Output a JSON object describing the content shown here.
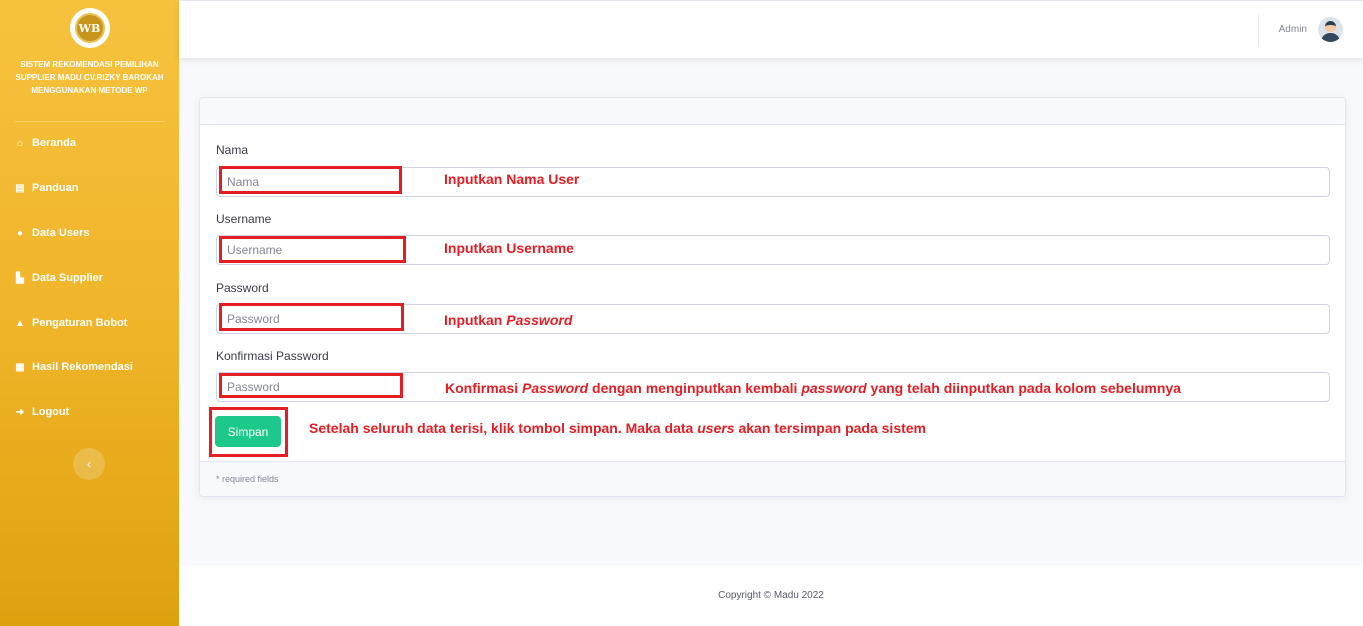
{
  "sidebar": {
    "logo_text": "WB",
    "brand_title": "SISTEM REKOMENDASI PEMILIHAN SUPPLIER MADU CV.RIZKY BAROKAH MENGGUNAKAN METODE WP",
    "items": [
      {
        "label": "Beranda",
        "icon": "home-icon"
      },
      {
        "label": "Panduan",
        "icon": "book-icon"
      },
      {
        "label": "Data Users",
        "icon": "users-icon"
      },
      {
        "label": "Data Supplier",
        "icon": "industry-icon"
      },
      {
        "label": "Pengaturan Bobot",
        "icon": "bell-icon"
      },
      {
        "label": "Hasil Rekomendasi",
        "icon": "calculator-icon"
      },
      {
        "label": "Logout",
        "icon": "sign-out-icon"
      }
    ],
    "toggle_icon": "‹"
  },
  "topbar": {
    "user_name": "Admin"
  },
  "form": {
    "fields": [
      {
        "label": "Nama",
        "placeholder": "Nama"
      },
      {
        "label": "Username",
        "placeholder": "Username"
      },
      {
        "label": "Password",
        "placeholder": "Password"
      },
      {
        "label": "Konfirmasi Password",
        "placeholder": "Password"
      }
    ],
    "save_label": "Simpan",
    "required_note": "* required fields"
  },
  "annotations": {
    "nama": "Inputkan Nama User",
    "username": "Inputkan Username",
    "password_prefix": "Inputkan ",
    "password_italic": "Password",
    "konfirmasi_1": "Konfirmasi ",
    "konfirmasi_2": "Password",
    "konfirmasi_3": " dengan menginputkan kembali ",
    "konfirmasi_4": "password",
    "konfirmasi_5": " yang telah diinputkan pada kolom sebelumnya",
    "simpan_1": "Setelah seluruh data terisi, klik tombol simpan. Maka data ",
    "simpan_2": "users",
    "simpan_3": " akan tersimpan pada sistem",
    "color": "#e31e24"
  },
  "footer": {
    "copyright": "Copyright © Madu 2022"
  }
}
